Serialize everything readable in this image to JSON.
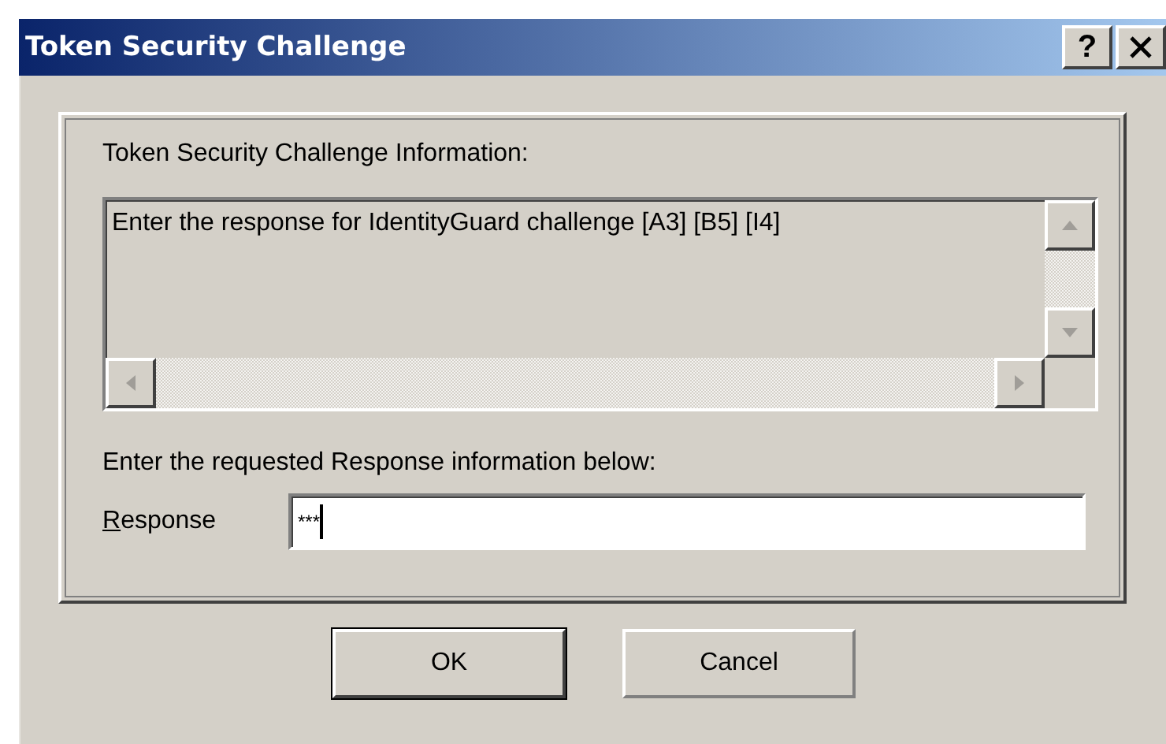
{
  "window": {
    "title": "Token Security Challenge",
    "help_button": "?"
  },
  "info": {
    "label": "Token Security Challenge Information:",
    "text": "Enter the response for IdentityGuard challenge [A3] [B5] [I4]"
  },
  "prompt": "Enter the requested Response information below:",
  "response": {
    "label": "Response",
    "access_key_underlined": true,
    "value": "***"
  },
  "buttons": [
    {
      "label": "OK",
      "default": true
    },
    {
      "label": "Cancel",
      "default": false
    }
  ]
}
